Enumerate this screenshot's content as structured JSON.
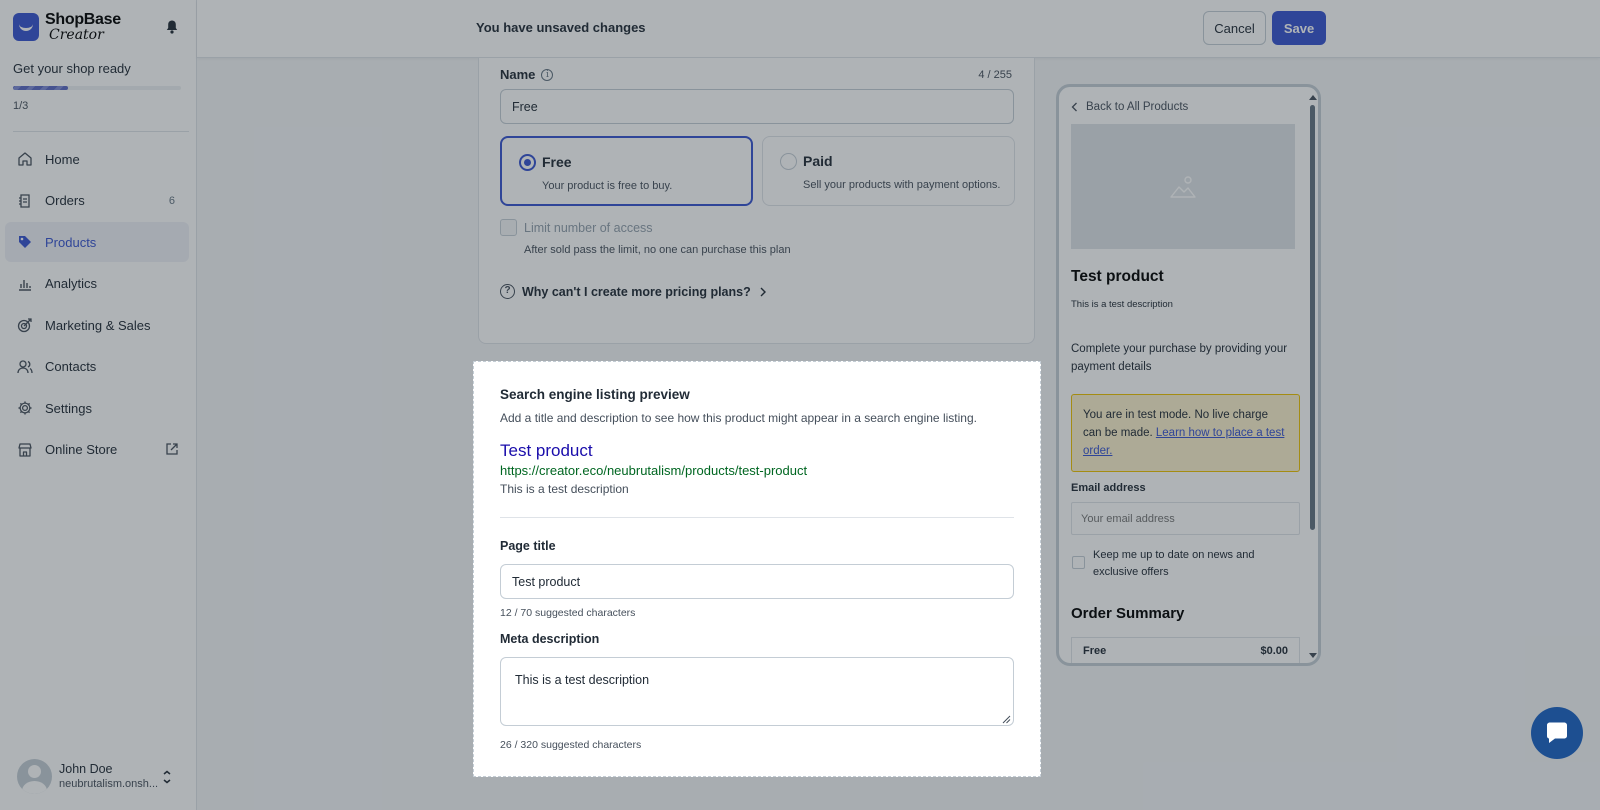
{
  "brand": {
    "line1": "ShopBase",
    "line2": "Creator",
    "accent": "#3753d0"
  },
  "onboarding": {
    "title": "Get your shop ready",
    "steps": "1/3",
    "progress_fraction": 0.33
  },
  "nav": [
    {
      "label": "Home",
      "icon": "home-icon"
    },
    {
      "label": "Orders",
      "icon": "orders-icon",
      "badge": "6"
    },
    {
      "label": "Products",
      "icon": "tag-icon",
      "active": true
    },
    {
      "label": "Analytics",
      "icon": "analytics-icon"
    },
    {
      "label": "Marketing & Sales",
      "icon": "marketing-icon"
    },
    {
      "label": "Contacts",
      "icon": "contacts-icon"
    },
    {
      "label": "Settings",
      "icon": "gear-icon"
    },
    {
      "label": "Online Store",
      "icon": "store-icon",
      "external": true
    }
  ],
  "user": {
    "name": "John Doe",
    "store": "neubrutalism.onsh..."
  },
  "topbar": {
    "message": "You have unsaved changes",
    "cancel_label": "Cancel",
    "save_label": "Save"
  },
  "pricing": {
    "name_label": "Name",
    "name_count": "4 / 255",
    "name_value": "Free",
    "plans": [
      {
        "title": "Free",
        "desc": "Your product is free to buy.",
        "selected": true
      },
      {
        "title": "Paid",
        "desc": "Sell your products with payment options.",
        "selected": false
      }
    ],
    "limit_label": "Limit number of access",
    "limit_help": "After sold pass the limit, no one can purchase this plan",
    "why_link": "Why can't I create more pricing plans?"
  },
  "seo": {
    "title": "Search engine listing preview",
    "subtitle": "Add a title and description to see how this product might appear in a search engine listing.",
    "preview_title": "Test product",
    "preview_url": "https://creator.eco/neubrutalism/products/test-product",
    "preview_desc": "This is a test description",
    "page_title_label": "Page title",
    "page_title_value": "Test product",
    "page_title_help": "12 / 70 suggested characters",
    "meta_label": "Meta description",
    "meta_value": "This is a test description",
    "meta_help": "26 / 320 suggested characters"
  },
  "preview": {
    "back": "Back to All Products",
    "title": "Test product",
    "desc": "This is a test description",
    "instructions": "Complete your purchase by providing your payment details",
    "notice_text": "You are in test mode. No live charge can be made.",
    "notice_link": "Learn how to place a test order.",
    "email_label": "Email address",
    "email_placeholder": "Your email address",
    "newsletter": "Keep me up to date on news and exclusive offers",
    "summary_title": "Order Summary",
    "summary_item": "Free",
    "summary_price": "$0.00"
  }
}
